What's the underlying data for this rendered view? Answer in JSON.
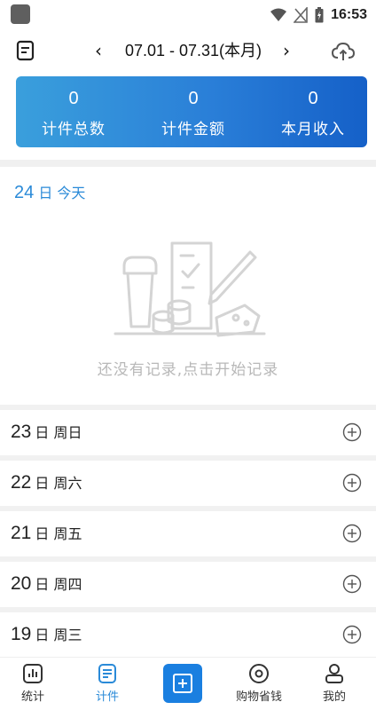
{
  "status_bar": {
    "time": "16:53"
  },
  "header": {
    "period": "07.01 - 07.31(本月)",
    "prev_label": "‹",
    "next_label": "›"
  },
  "summary": [
    {
      "value": "0",
      "label": "计件总数"
    },
    {
      "value": "0",
      "label": "计件金额"
    },
    {
      "value": "0",
      "label": "本月收入"
    }
  ],
  "today": {
    "day": "24",
    "suffix": "日 今天"
  },
  "empty_state": {
    "message": "还没有记录,点击开始记录"
  },
  "days": [
    {
      "day": "23",
      "suffix": "日 周日"
    },
    {
      "day": "22",
      "suffix": "日 周六"
    },
    {
      "day": "21",
      "suffix": "日 周五"
    },
    {
      "day": "20",
      "suffix": "日 周四"
    },
    {
      "day": "19",
      "suffix": "日 周三"
    }
  ],
  "nav": {
    "stats": "统计",
    "piece": "计件",
    "shop": "购物省钱",
    "mine": "我的"
  },
  "colors": {
    "accent": "#2a8ad8",
    "card_start": "#3a9fdc",
    "card_end": "#1560c8"
  }
}
